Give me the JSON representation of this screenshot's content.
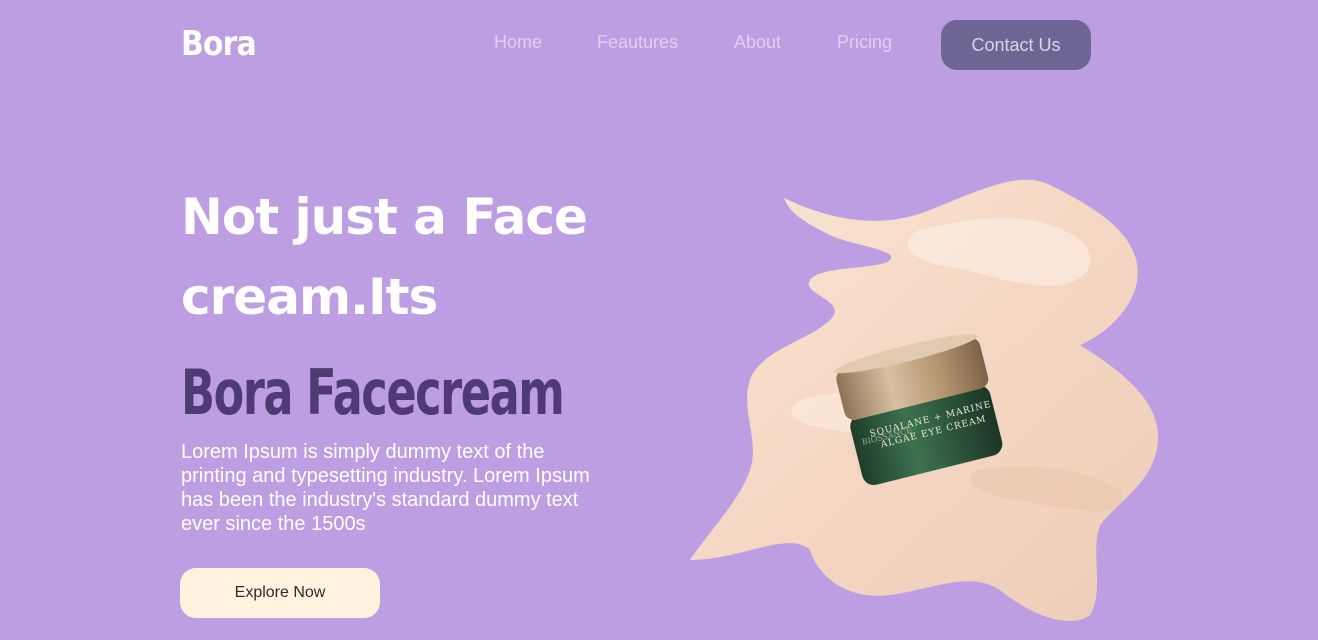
{
  "header": {
    "logo": "Bora",
    "nav": [
      "Home",
      "Feautures",
      "About",
      "Pricing"
    ],
    "contact_label": "Contact Us"
  },
  "hero": {
    "heading_line1": "Not just a Face",
    "heading_line2": "cream.Its",
    "brand_line": "Bora Facecream",
    "description": "Lorem Ipsum is simply dummy text of the printing and typesetting industry. Lorem Ipsum has been the industry's standard dummy text ever since the 1500s",
    "cta_label": "Explore Now"
  },
  "product": {
    "label_line1": "SQUALANE + MARINE",
    "label_line2": "ALGAE EYE CREAM",
    "side_text": "BIOSSANCE"
  },
  "colors": {
    "background": "#bd9ee2",
    "brand_text": "#4f3b73",
    "contact_button": "#6d6594",
    "cta_button": "#fff3e0",
    "cream": "#f6dcc9",
    "jar_glass": "#2f5a3c",
    "jar_lid": "#b89a76"
  }
}
